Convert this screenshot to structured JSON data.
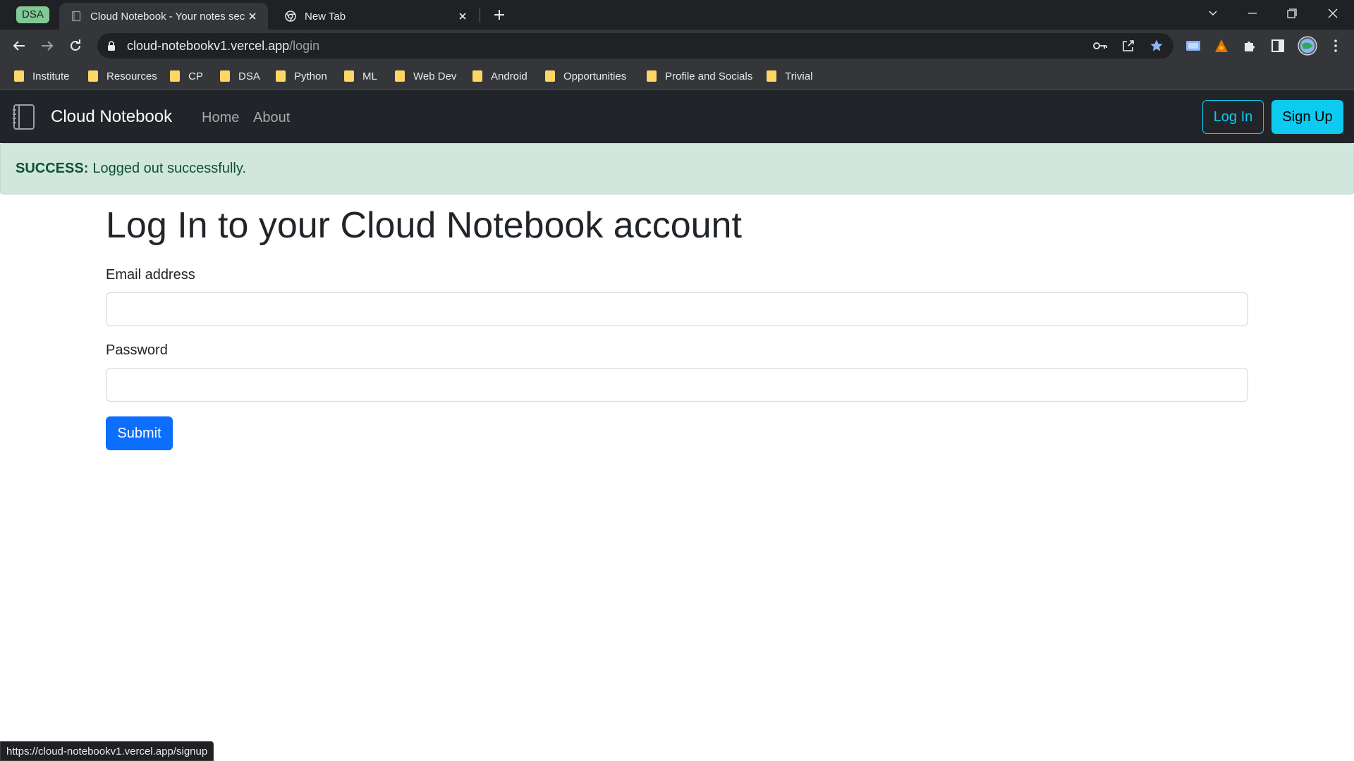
{
  "browser": {
    "tab_group": "DSA",
    "tabs": [
      {
        "title": "Cloud Notebook - Your notes secured in the cloud",
        "active": true
      },
      {
        "title": "New Tab",
        "active": false
      }
    ],
    "url_host": "cloud-notebookv1.vercel.app",
    "url_path": "/login",
    "bookmarks": [
      "Institute",
      "Resources",
      "CP",
      "DSA",
      "Python",
      "ML",
      "Web Dev",
      "Android",
      "Opportunities",
      "Profile and Socials",
      "Trivial"
    ],
    "status_url": "https://cloud-notebookv1.vercel.app/signup"
  },
  "navbar": {
    "brand": "Cloud Notebook",
    "links": [
      "Home",
      "About"
    ],
    "login_label": "Log In",
    "signup_label": "Sign Up"
  },
  "alert": {
    "type": "SUCCESS:",
    "message": "Logged out successfully."
  },
  "main": {
    "title": "Log In to your Cloud Notebook account",
    "email_label": "Email address",
    "email_value": "",
    "password_label": "Password",
    "password_value": "",
    "submit_label": "Submit"
  },
  "colors": {
    "navbar_bg": "#212529",
    "info": "#0dcaf0",
    "primary": "#0d6efd",
    "alert_bg": "#d1e7dd",
    "alert_text": "#0f5132"
  }
}
